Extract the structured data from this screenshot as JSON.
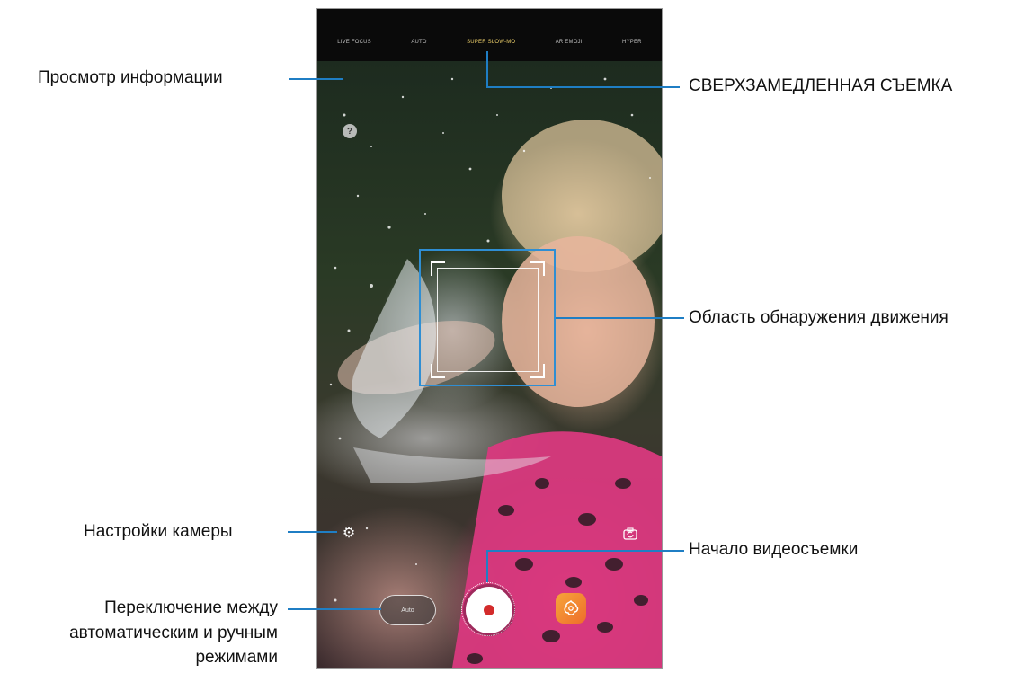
{
  "camera": {
    "modes": [
      "LIVE FOCUS",
      "AUTO",
      "SUPER SLOW-MO",
      "AR EMOJI",
      "HYPER"
    ],
    "active_mode_index": 2,
    "help_glyph": "?",
    "auto_button_label": "Auto",
    "icons": {
      "help": "question-circle-icon",
      "settings": "gear-icon",
      "switch_camera": "switch-camera-icon",
      "record": "record-icon",
      "gallery": "bixby-vision-flower-icon"
    },
    "colors": {
      "accent_line": "#1f7ec4",
      "motion_frame": "#2f8ed3",
      "record_dot": "#d32b2b",
      "active_mode": "#f1d36c"
    }
  },
  "callouts": {
    "info": "Просмотр информации",
    "super_slow": "СВЕРХЗАМЕДЛЕННАЯ СЪЕМКА",
    "motion_area": "Область обнаружения движения",
    "settings": "Настройки камеры",
    "record_start": "Начало видеосъемки",
    "mode_switch_line1": "Переключение между",
    "mode_switch_line2": "автоматическим и ручным",
    "mode_switch_line3": "режимами"
  }
}
